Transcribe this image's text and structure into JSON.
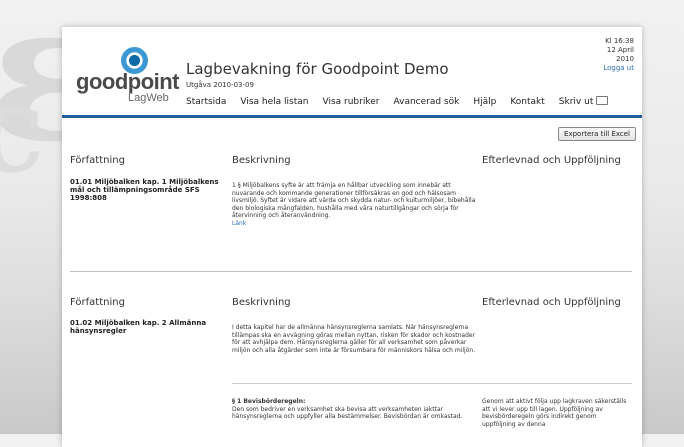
{
  "brand": {
    "logo_word": "goodpoint",
    "logo_sub": "LagWeb"
  },
  "header": {
    "title": "Lagbevakning för Goodpoint Demo",
    "edition": "Utgåva 2010-03-09",
    "time": "Kl 16:38",
    "date_line1": "12 April",
    "date_line2": "2010",
    "logout": "Logga ut"
  },
  "nav": {
    "items": [
      "Startsida",
      "Visa hela listan",
      "Visa rubriker",
      "Avancerad sök",
      "Hjälp",
      "Kontakt",
      "Skriv ut"
    ]
  },
  "export_label": "Exportera till Excel",
  "columns": {
    "law": "Författning",
    "desc": "Beskrivning",
    "follow": "Efterlevnad och Uppföljning"
  },
  "entries": [
    {
      "law": "01.01 Miljöbalken kap. 1 Miljöbalkens mål och tillämpningsområde SFS 1998:808",
      "desc": "1 § Miljöbalkens syfte är att främja en hållbar utveckling som innebär att nuvarande och kommande generationer tillförsäkras en god och hälsosam livsmiljö. Syftet är vidare att värda och skydda natur- och kulturmiljöer, bibehålla den biologiska mångfalden, hushålla med våra naturtillgångar och sörja för återvinning och återanvändning.",
      "link": "Länk"
    },
    {
      "law": "01.02 Miljöbalken kap. 2 Allmänna hänsynsregler",
      "desc": "I detta kapitel har de allmänna hänsynsreglerna samlats. När hänsynsreglerna tillämpas ska en avvägning göras mellan nyttan, risken för skador och kostnader för att avhjälpa dem. Hänsynsreglerna gäller för all verksamhet som påverkar miljön och alla åtgärder som inte är försumbara för människors hälsa och miljön.",
      "sub_title": "§ 1 Bevisbörderegeln:",
      "sub_text": "Den som bedriver en verksamhet ska bevisa att verksamheten iakttar hänsynsreglerna och uppfyller alla bestämmelser. Bevisbördan är omkastad.",
      "follow": "Genom att aktivt följa upp lagkraven säkerställs att vi lever upp till lagen. Uppföljning av bevisbörderegeln görs indirekt genom uppföljning av denna"
    }
  ]
}
